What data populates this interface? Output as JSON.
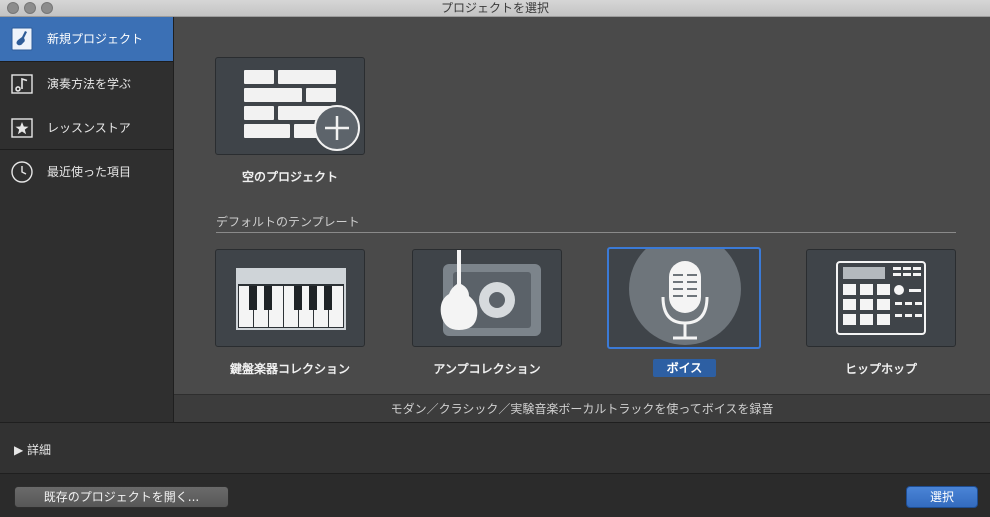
{
  "window": {
    "title": "プロジェクトを選択"
  },
  "sidebar": {
    "items": [
      {
        "label": "新規プロジェクト",
        "icon": "guitar-document-icon",
        "active": true
      },
      {
        "label": "演奏方法を学ぶ",
        "icon": "music-note-icon",
        "active": false
      },
      {
        "label": "レッスンストア",
        "icon": "star-icon",
        "active": false
      },
      {
        "label": "最近使った項目",
        "icon": "clock-icon",
        "active": false
      }
    ]
  },
  "main": {
    "empty_project": {
      "label": "空のプロジェクト",
      "icon": "empty-project-add-icon"
    },
    "section_title": "デフォルトのテンプレート",
    "templates": [
      {
        "label": "鍵盤楽器コレクション",
        "icon": "piano-keyboard-icon",
        "selected": false
      },
      {
        "label": "アンプコレクション",
        "icon": "guitar-amp-icon",
        "selected": false
      },
      {
        "label": "ボイス",
        "icon": "microphone-icon",
        "selected": true
      },
      {
        "label": "ヒップホップ",
        "icon": "drum-machine-icon",
        "selected": false
      }
    ],
    "description": "モダン／クラシック／実験音楽ボーカルトラックを使ってボイスを録音"
  },
  "details": {
    "label": "▶ 詳細"
  },
  "footer": {
    "open_button": "既存のプロジェクトを開く...",
    "select_button": "選択"
  },
  "colors": {
    "accent": "#3b70b5",
    "selected_border": "#3b7ad6"
  }
}
